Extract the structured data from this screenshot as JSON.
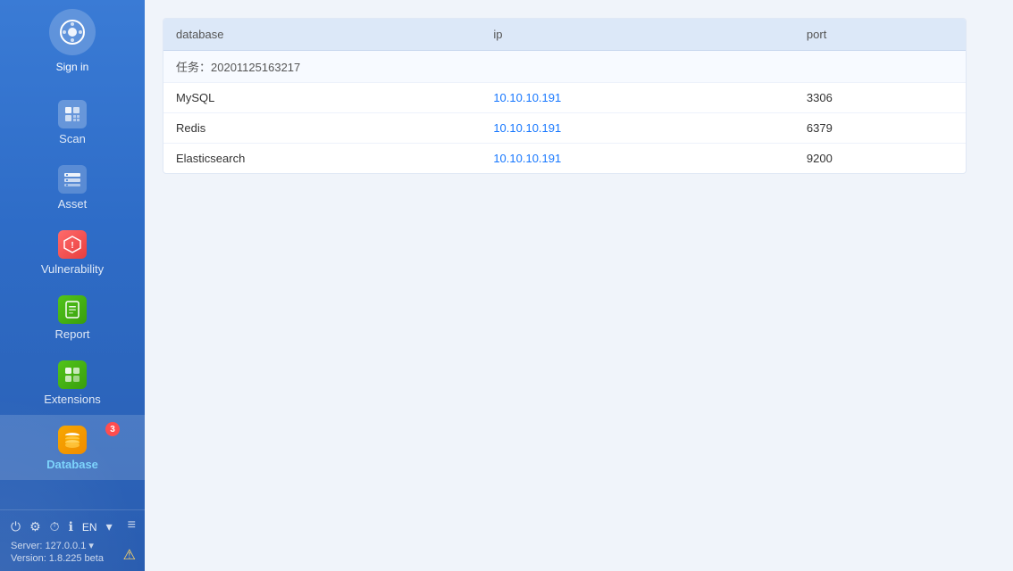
{
  "sidebar": {
    "logo_label": "Sign in",
    "items": [
      {
        "id": "scan",
        "label": "Scan",
        "active": false
      },
      {
        "id": "asset",
        "label": "Asset",
        "active": false
      },
      {
        "id": "vulnerability",
        "label": "Vulnerability",
        "active": false
      },
      {
        "id": "report",
        "label": "Report",
        "active": false
      },
      {
        "id": "extensions",
        "label": "Extensions",
        "active": false
      },
      {
        "id": "database",
        "label": "Database",
        "active": true,
        "badge": "3"
      }
    ],
    "server_label": "Server:",
    "server_value": "127.0.0.1",
    "version_label": "Version: 1.8.225 beta",
    "lang": "EN"
  },
  "table": {
    "columns": [
      {
        "key": "database",
        "label": "database"
      },
      {
        "key": "ip",
        "label": "ip"
      },
      {
        "key": "port",
        "label": "port"
      }
    ],
    "task_row": "任务：20201125163217",
    "rows": [
      {
        "database": "MySQL",
        "ip": "10.10.10.191",
        "port": "3306"
      },
      {
        "database": "Redis",
        "ip": "10.10.10.191",
        "port": "6379"
      },
      {
        "database": "Elasticsearch",
        "ip": "10.10.10.191",
        "port": "9200"
      }
    ]
  }
}
